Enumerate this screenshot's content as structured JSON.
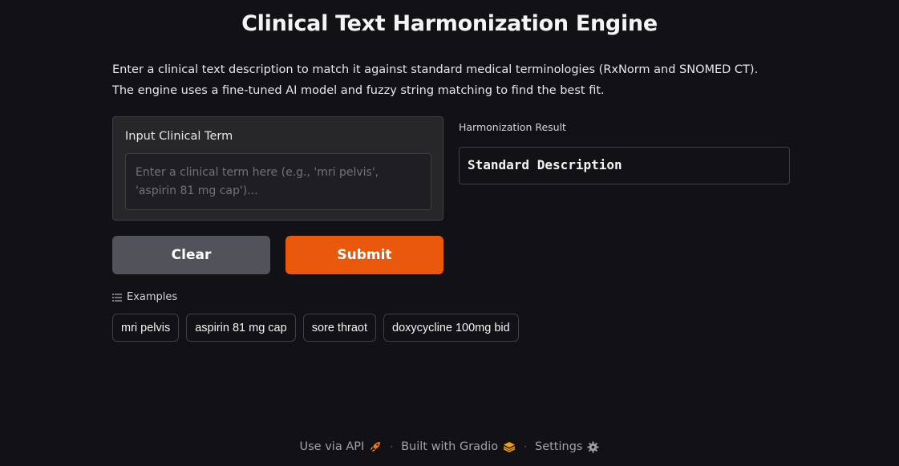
{
  "title": "Clinical Text Harmonization Engine",
  "description": "Enter a clinical text description to match it against standard medical terminologies (RxNorm and SNOMED CT). The engine uses a fine-tuned AI model and fuzzy string matching to find the best fit.",
  "input": {
    "label": "Input Clinical Term",
    "value": "",
    "placeholder": "Enter a clinical term here (e.g., 'mri pelvis', 'aspirin 81 mg cap')..."
  },
  "buttons": {
    "clear": "Clear",
    "submit": "Submit"
  },
  "result": {
    "label": "Harmonization Result",
    "text": "Standard Description"
  },
  "examples": {
    "label": "Examples",
    "items": [
      "mri pelvis",
      "aspirin 81 mg cap",
      "sore thraot",
      "doxycycline 100mg bid"
    ]
  },
  "footer": {
    "api": "Use via API",
    "built": "Built with Gradio",
    "settings": "Settings",
    "separator": "·"
  },
  "colors": {
    "background": "#121116",
    "accent": "#ea580c",
    "secondary_button": "#52525b"
  },
  "icons": {
    "examples": "list-icon",
    "api": "rocket-icon",
    "gradio": "gradio-logo-icon",
    "settings": "gear-icon"
  }
}
